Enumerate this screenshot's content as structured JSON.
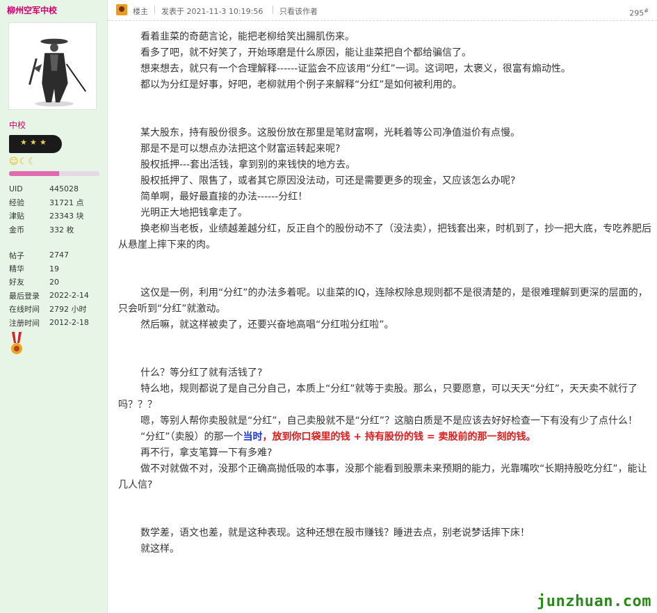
{
  "sidebar": {
    "username": "柳州空军中校",
    "group_title": "中校",
    "level_icons": "☺☾☾",
    "credit_fraction": 0.55,
    "stats": [
      {
        "label": "UID",
        "value": "445028"
      },
      {
        "label": "经验",
        "value": "31721 点"
      },
      {
        "label": "津贴",
        "value": "23343 块"
      },
      {
        "label": "金币",
        "value": "332 枚"
      }
    ],
    "stats2": [
      {
        "label": "帖子",
        "value": "2747"
      },
      {
        "label": "精华",
        "value": "19"
      },
      {
        "label": "好友",
        "value": "20"
      },
      {
        "label": "最后登录",
        "value": "2022-2-14"
      },
      {
        "label": "在线时间",
        "value": "2792 小时"
      },
      {
        "label": "注册时间",
        "value": "2012-2-18"
      }
    ],
    "colors": {
      "name": "#d6006a",
      "panel": "#e7f5e6"
    }
  },
  "header": {
    "role": "楼主",
    "posted": "发表于 2021-11-3 10:19:56",
    "only_author": "只看该作者",
    "floor_number": "295",
    "floor_suffix": "#"
  },
  "post": {
    "p1": "看着韭菜的奇葩言论，能把老柳给笑出腸肌伤来。",
    "p2": "看多了吧，就不好笑了，开始琢磨是什么原因，能让韭菜把自个都给骗信了。",
    "p3": "想来想去，就只有一个合理解释------证监会不应该用“分红”一词。这词吧，太褒义，很富有煽动性。",
    "p4": "都以为分红是好事，好吧，老柳就用个例子来解释“分红”是如何被利用的。",
    "p5": "某大股东，持有股份很多。这股份放在那里是笔财富啊，光耗着等公司净值溢价有点慢。",
    "p6": "那是不是可以想点办法把这个财富运转起来呢?",
    "p7": "股权抵押---套出活钱，拿到别的来钱快的地方去。",
    "p8": "股权抵押了、限售了，或者其它原因没法动，可还是需要更多的现金，又应该怎么办呢?",
    "p9": "简单啊，最好最直接的办法------分红！",
    "p10": "光明正大地把钱拿走了。",
    "p11": "换老柳当老板，业绩越差越分红，反正自个的股份动不了（没法卖），把钱套出来，时机到了，抄一把大底，专吃养肥后从悬崖上摔下来的肉。",
    "p12": "这仅是一例，利用“分红”的办法多着呢。以韭菜的IQ，连除权除息规则都不是很清楚的，是很难理解到更深的层面的，只会听到“分红”就激动。",
    "p13": "然后嘛，就这样被卖了，还要兴奋地高唱“分红啦分红啦”。",
    "p14": "什么？等分红了就有活钱了?",
    "p15": "特么地，规则都说了是自己分自己，本质上“分红”就等于卖股。那么，只要愿意，可以天天“分红”，天天卖不就行了吗？？？",
    "p16": "嗯，等别人帮你卖股就是“分红”，自己卖股就不是“分红”？这脑白质是不是应该去好好检查一下有没有少了点什么！",
    "p17_a": "“分红”（卖股）的那一个",
    "p17_b": "当时",
    "p17_c": "，",
    "p17_d": "放到你口袋里的钱 + 持有股份的钱 = 卖股前的那一刻的钱",
    "p17_e": "。",
    "p18": "再不行，拿支笔算一下有多难?",
    "p19": "做不对就做不对，没那个正确高抛低吸的本事，没那个能看到股票未来预期的能力，光靠嘴吹“长期持股吃分红”，能让几人信?",
    "p20": "数学差，语文也差，就是这种表现。这种还想在股市赚钱？睡进去点，别老说梦话摔下床！",
    "p21": "就这样。"
  },
  "watermark": "junzhuan.com"
}
